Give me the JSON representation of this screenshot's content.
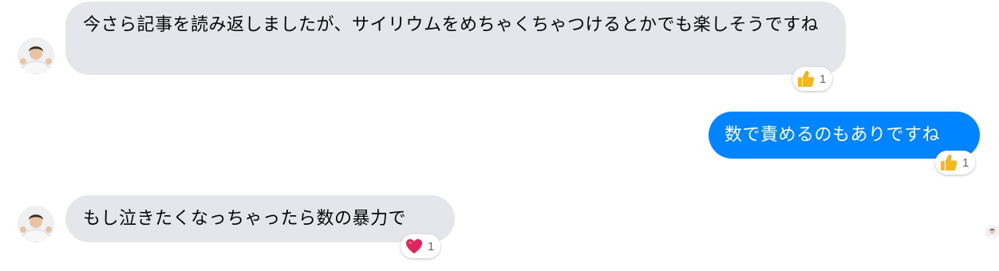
{
  "conversation": {
    "messages": [
      {
        "direction": "incoming",
        "text": "今さら記事を読み返しましたが、サイリウムをめちゃくちゃつけるとかでも楽しそうですね",
        "reaction": {
          "icon": "thumbs-up-icon",
          "count": "1"
        }
      },
      {
        "direction": "outgoing",
        "text": "数で責めるのもありですね",
        "reaction": {
          "icon": "thumbs-up-icon",
          "count": "1"
        }
      },
      {
        "direction": "incoming",
        "text": "もし泣きたくなっちゃったら数の暴力で",
        "reaction": {
          "icon": "heart-icon",
          "count": "1"
        }
      }
    ]
  },
  "colors": {
    "incoming_bubble": "#e4e6eb",
    "outgoing_bubble": "#0084ff",
    "outgoing_text": "#ffffff",
    "reaction_count": "#65676b",
    "heart": "#e0245e",
    "thumbs_up": "#f5b81e"
  }
}
